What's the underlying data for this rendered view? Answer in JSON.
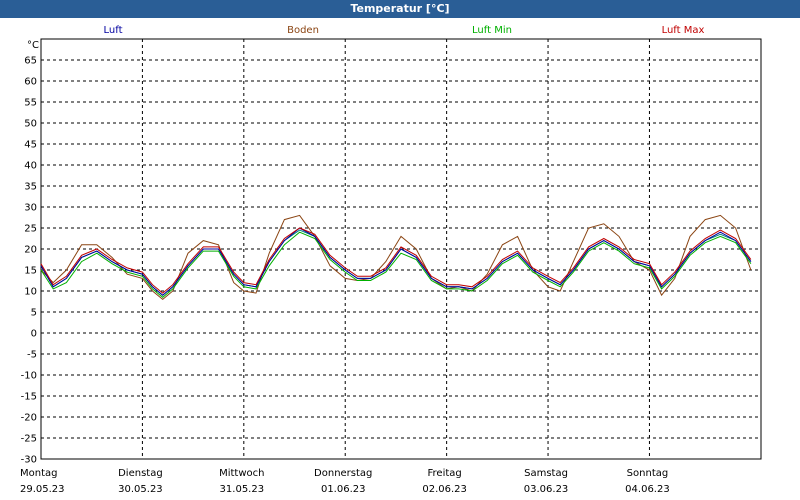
{
  "window": {
    "title": "Temperatur [°C]"
  },
  "colors": {
    "header_bg": "#2a5e96",
    "Luft": "#0000a0",
    "Boden": "#8b4513",
    "Luft Min": "#00b000",
    "Luft Max": "#c00000",
    "extra": "#008080"
  },
  "chart_data": {
    "type": "line",
    "title": "Temperatur [°C]",
    "ylabel": "°C",
    "ylim": [
      -30,
      70
    ],
    "yticks": [
      65,
      60,
      55,
      50,
      45,
      40,
      35,
      30,
      25,
      20,
      15,
      10,
      5,
      0,
      -5,
      -10,
      -15,
      -20,
      -25,
      -30
    ],
    "grid": true,
    "legend_position": "top",
    "x_unit": "days from 29.05.23 00:00",
    "xlim": [
      0,
      7.1
    ],
    "day_labels": [
      {
        "weekday": "Montag",
        "date": "29.05.23"
      },
      {
        "weekday": "Dienstag",
        "date": "30.05.23"
      },
      {
        "weekday": "Mittwoch",
        "date": "31.05.23"
      },
      {
        "weekday": "Donnerstag",
        "date": "01.06.23"
      },
      {
        "weekday": "Freitag",
        "date": "02.06.23"
      },
      {
        "weekday": "Samstag",
        "date": "03.06.23"
      },
      {
        "weekday": "Sonntag",
        "date": "04.06.23"
      }
    ],
    "x": [
      0,
      0.12,
      0.25,
      0.4,
      0.55,
      0.7,
      0.85,
      1.0,
      1.1,
      1.2,
      1.3,
      1.45,
      1.6,
      1.75,
      1.9,
      2.0,
      2.12,
      2.25,
      2.4,
      2.55,
      2.7,
      2.85,
      3.0,
      3.12,
      3.25,
      3.4,
      3.55,
      3.7,
      3.85,
      4.0,
      4.12,
      4.25,
      4.4,
      4.55,
      4.7,
      4.85,
      5.0,
      5.12,
      5.25,
      5.4,
      5.55,
      5.7,
      5.85,
      6.0,
      6.12,
      6.25,
      6.4,
      6.55,
      6.7,
      6.85,
      7.0
    ],
    "series": [
      {
        "name": "Luft",
        "values": [
          16,
          11,
          13,
          18,
          19.5,
          17,
          15,
          14,
          11,
          9,
          11,
          16,
          20,
          20,
          14,
          11.5,
          11,
          17,
          22,
          25,
          23,
          18,
          15,
          13,
          13,
          15,
          20,
          18,
          13,
          11,
          11,
          10.5,
          13,
          17,
          19,
          15,
          13,
          11.5,
          15,
          20,
          22,
          20,
          17,
          16,
          11,
          14,
          19,
          22,
          24,
          22,
          17
        ]
      },
      {
        "name": "Boden",
        "values": [
          15,
          12,
          15,
          21,
          21,
          18,
          14,
          13,
          10,
          8,
          10,
          19,
          22,
          21,
          12,
          10,
          9.5,
          19,
          27,
          28,
          23,
          16,
          13,
          12.5,
          13,
          17,
          23,
          20,
          13,
          10.5,
          11,
          10,
          14,
          21,
          23,
          15,
          11,
          10,
          17,
          25,
          26,
          23,
          17,
          15,
          9,
          13,
          23,
          27,
          28,
          25,
          15
        ]
      },
      {
        "name": "Luft Min",
        "values": [
          15,
          10.5,
          12,
          17,
          19,
          16.5,
          14.5,
          13.5,
          10.5,
          8.5,
          10.5,
          15.5,
          19.5,
          19.5,
          13.5,
          11,
          10.5,
          16,
          21,
          24,
          22.5,
          17.5,
          14.5,
          12.5,
          12.5,
          14.5,
          19,
          17.5,
          12.5,
          10.5,
          10.5,
          10,
          12.5,
          16.5,
          18.5,
          14.5,
          12.5,
          11,
          14.5,
          19.5,
          21.5,
          19.5,
          16.5,
          15.5,
          10.5,
          13.5,
          18.5,
          21.5,
          23,
          21.5,
          16.5
        ]
      },
      {
        "name": "Luft Max",
        "values": [
          16.5,
          11.5,
          13.5,
          18.5,
          20,
          17.5,
          15.5,
          14.5,
          11.5,
          9.5,
          11.5,
          16.5,
          20.5,
          20.5,
          14.5,
          12,
          11.5,
          17.5,
          22.5,
          25,
          23.5,
          18.5,
          15.5,
          13.5,
          13.5,
          15.5,
          20.5,
          18.5,
          13.5,
          11.5,
          11.5,
          11,
          13.5,
          17.5,
          19.5,
          15.5,
          13.5,
          12,
          15.5,
          20.5,
          22.5,
          20.5,
          17.5,
          16.5,
          11.5,
          14.5,
          19.5,
          22.5,
          24.5,
          22.5,
          17.5
        ]
      },
      {
        "values": [
          16,
          11,
          13,
          18,
          19.5,
          17,
          15,
          14,
          11,
          9,
          11,
          16,
          20,
          20,
          14,
          11.5,
          11,
          17,
          22,
          24.5,
          23,
          18,
          15,
          13,
          13,
          15,
          20,
          18,
          13,
          11,
          11,
          10.5,
          13,
          17,
          19,
          15,
          13,
          11.5,
          15,
          20,
          22,
          20,
          17,
          16,
          11,
          14,
          19,
          22,
          23.5,
          22,
          17
        ]
      }
    ]
  }
}
